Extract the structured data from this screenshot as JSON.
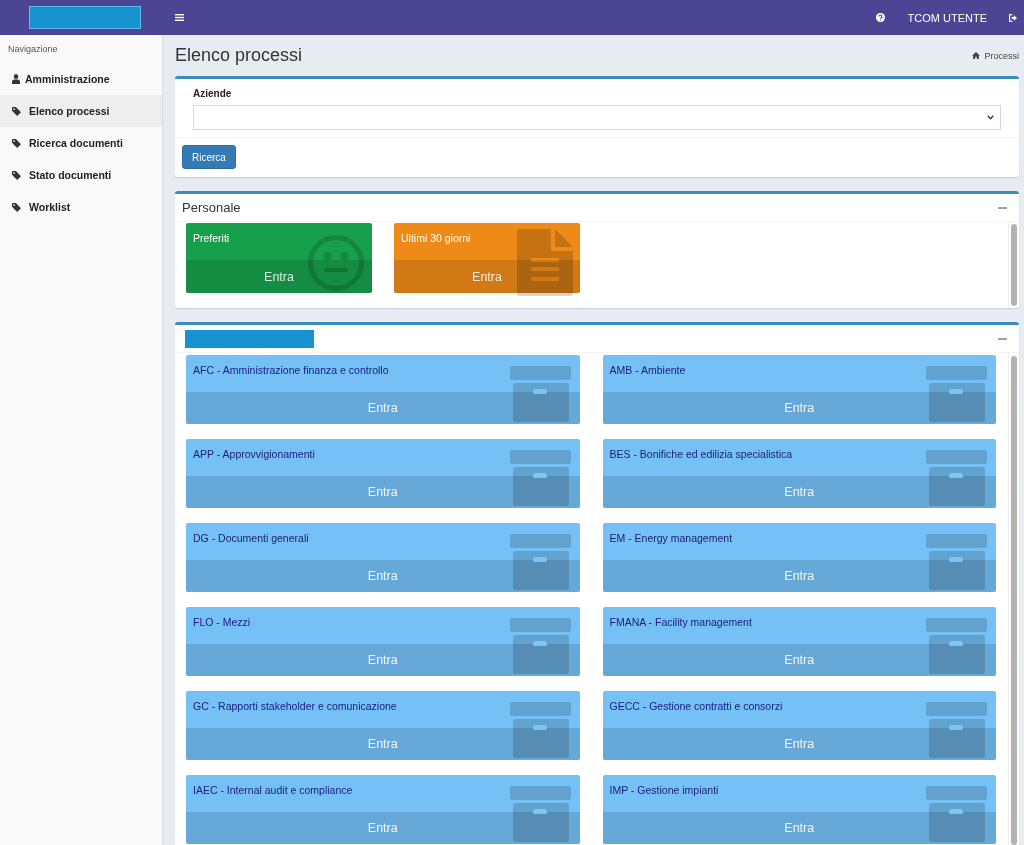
{
  "topbar": {
    "user": "TCOM UTENTE"
  },
  "sidebar": {
    "heading": "Navigazione",
    "items": [
      {
        "label": "Amministrazione",
        "kind": "user",
        "selected": false
      },
      {
        "label": "Elenco processi",
        "kind": "tag",
        "selected": true
      },
      {
        "label": "Ricerca documenti",
        "kind": "tag",
        "selected": false
      },
      {
        "label": "Stato documenti",
        "kind": "tag",
        "selected": false
      },
      {
        "label": "Worklist",
        "kind": "tag",
        "selected": false
      }
    ]
  },
  "page": {
    "title": "Elenco processi",
    "breadcrumb": "Processi"
  },
  "filter": {
    "label": "Aziende",
    "button": "Ricerca"
  },
  "personal": {
    "title": "Personale",
    "expanded": true,
    "tiles": [
      {
        "title": "Preferiti",
        "kind": "face",
        "color": "#17a04b",
        "action": "Entra"
      },
      {
        "title": "Ultimi 30 giorni",
        "kind": "document",
        "color": "#ee8a17",
        "action": "Entra"
      }
    ]
  },
  "processes": {
    "expanded": true,
    "tiles": [
      {
        "title": "AFC - Amministrazione finanza e controllo",
        "action": "Entra"
      },
      {
        "title": "AMB - Ambiente",
        "action": "Entra"
      },
      {
        "title": "APP - Approvvigionamenti",
        "action": "Entra"
      },
      {
        "title": "BES - Bonifiche ed edilizia specialistica",
        "action": "Entra"
      },
      {
        "title": "DG - Documenti generali",
        "action": "Entra"
      },
      {
        "title": "EM - Energy management",
        "action": "Entra"
      },
      {
        "title": "FLO - Mezzi",
        "action": "Entra"
      },
      {
        "title": "FMANA - Facility management",
        "action": "Entra"
      },
      {
        "title": "GC - Rapporti stakeholder e comunicazione",
        "action": "Entra"
      },
      {
        "title": "GECC - Gestione contratti e consorzi",
        "action": "Entra"
      },
      {
        "title": "IAEC - Internal audit e compliance",
        "action": "Entra"
      },
      {
        "title": "IMP - Gestione impianti",
        "action": "Entra"
      }
    ]
  }
}
